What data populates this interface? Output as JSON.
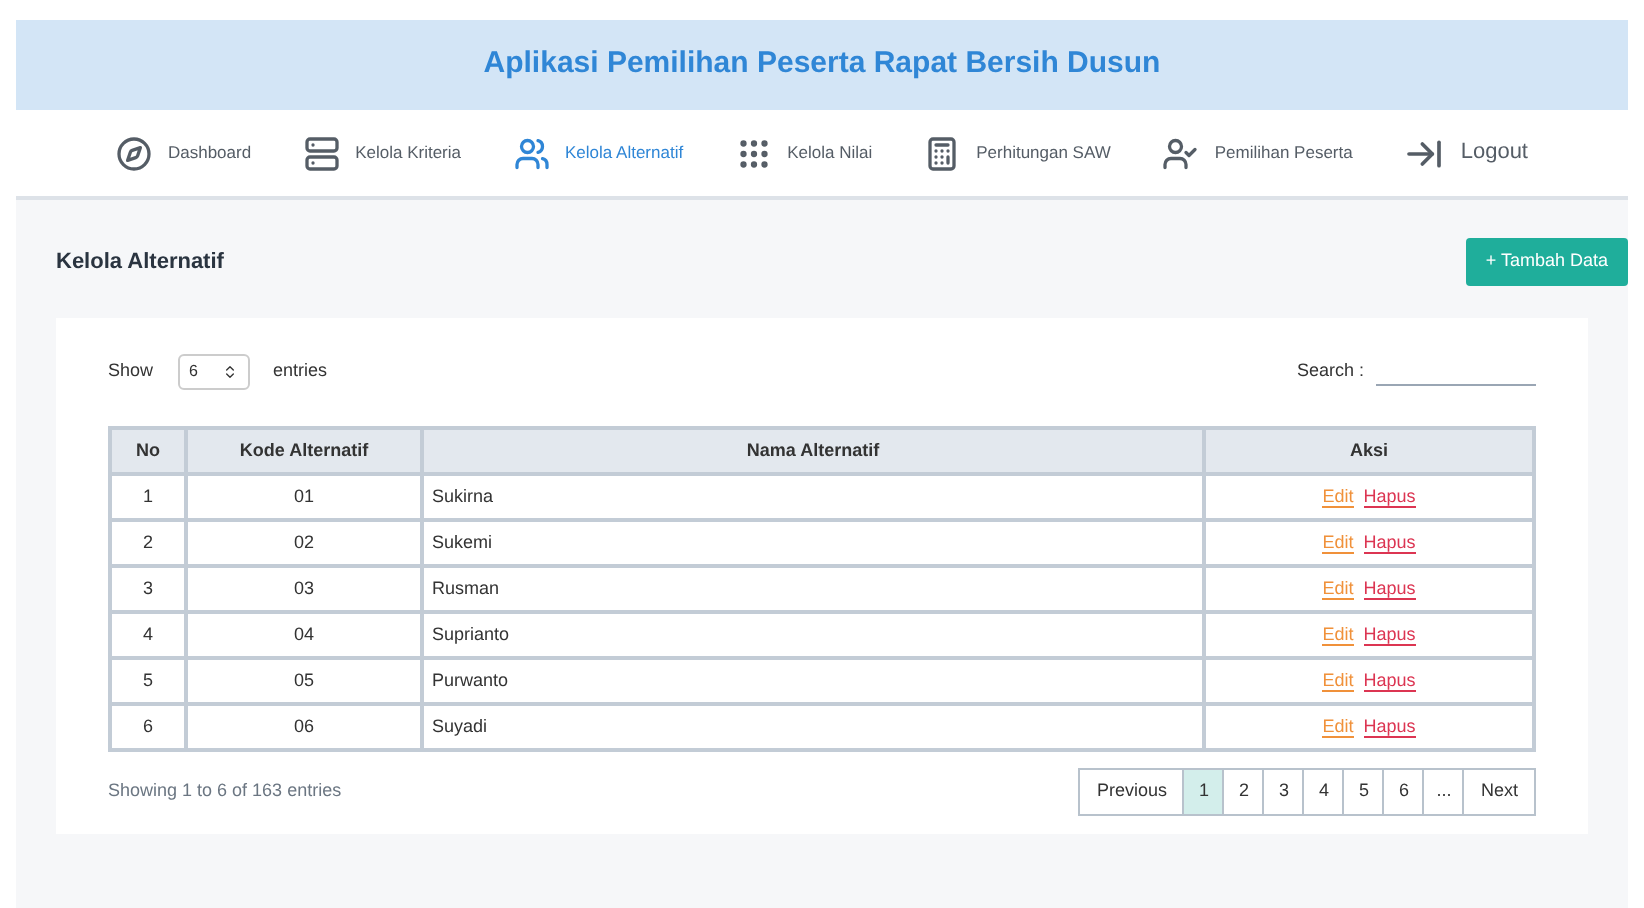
{
  "header": {
    "title": "Aplikasi Pemilihan Peserta Rapat Bersih Dusun"
  },
  "nav": [
    {
      "label": "Dashboard",
      "selected": false
    },
    {
      "label": "Kelola Kriteria",
      "selected": false
    },
    {
      "label": "Kelola Alternatif",
      "selected": true
    },
    {
      "label": "Kelola Nilai",
      "selected": false
    },
    {
      "label": "Perhitungan SAW",
      "selected": false
    },
    {
      "label": "Pemilihan Peserta",
      "selected": false
    },
    {
      "label": "Logout",
      "selected": false
    }
  ],
  "page": {
    "title": "Kelola Alternatif",
    "add_button": "+ Tambah Data"
  },
  "controls": {
    "show_label": "Show",
    "entries_value": "6",
    "entries_label": "entries",
    "search_label": "Search :"
  },
  "table": {
    "columns": [
      "No",
      "Kode Alternatif",
      "Nama Alternatif",
      "Aksi"
    ],
    "rows": [
      {
        "no": "1",
        "kode": "01",
        "nama": "Sukirna",
        "edit": "Edit",
        "hapus": "Hapus"
      },
      {
        "no": "2",
        "kode": "02",
        "nama": "Sukemi",
        "edit": "Edit",
        "hapus": "Hapus"
      },
      {
        "no": "3",
        "kode": "03",
        "nama": "Rusman",
        "edit": "Edit",
        "hapus": "Hapus"
      },
      {
        "no": "4",
        "kode": "04",
        "nama": "Suprianto",
        "edit": "Edit",
        "hapus": "Hapus"
      },
      {
        "no": "5",
        "kode": "05",
        "nama": "Purwanto",
        "edit": "Edit",
        "hapus": "Hapus"
      },
      {
        "no": "6",
        "kode": "06",
        "nama": "Suyadi",
        "edit": "Edit",
        "hapus": "Hapus"
      }
    ]
  },
  "footer": {
    "info": "Showing 1 to 6 of 163 entries",
    "pagination": [
      {
        "label": "Previous",
        "selected": false
      },
      {
        "label": "1",
        "selected": true
      },
      {
        "label": "2",
        "selected": false
      },
      {
        "label": "3",
        "selected": false
      },
      {
        "label": "4",
        "selected": false
      },
      {
        "label": "5",
        "selected": false
      },
      {
        "label": "6",
        "selected": false
      },
      {
        "label": "...",
        "selected": false
      },
      {
        "label": "Next",
        "selected": false
      }
    ]
  }
}
